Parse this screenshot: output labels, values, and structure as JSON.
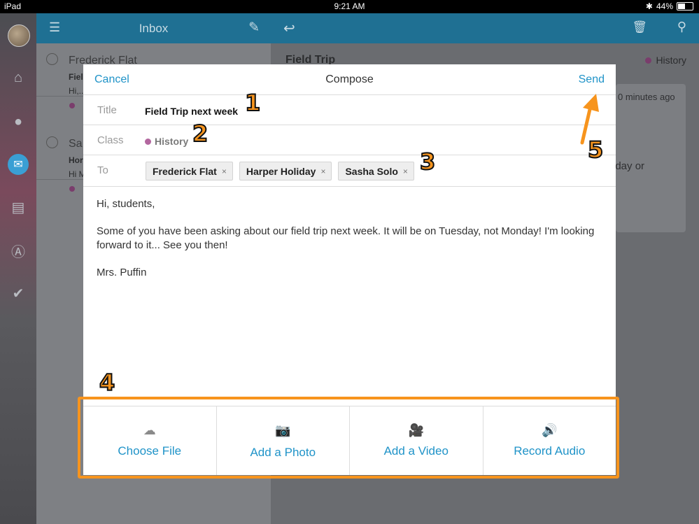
{
  "status_bar": {
    "device": "iPad",
    "time": "9:21 AM",
    "battery": "44%"
  },
  "inbox": {
    "title": "Inbox",
    "messages": [
      {
        "from": "Frederick Flat",
        "subject": "Fiel",
        "preview": "Hi,..."
      },
      {
        "from": "Sa",
        "subject": "Hor",
        "preview": "Hi M"
      }
    ]
  },
  "detail": {
    "subject": "Field Trip",
    "class": "History",
    "time": "0 minutes ago",
    "snippet": "nday or"
  },
  "compose": {
    "cancel": "Cancel",
    "title": "Compose",
    "send": "Send",
    "title_label": "Title",
    "title_value": "Field Trip next week",
    "class_label": "Class",
    "class_value": "History",
    "to_label": "To",
    "recipients": [
      "Frederick Flat",
      "Harper Holiday",
      "Sasha Solo"
    ],
    "body": [
      "Hi, students,",
      "Some of you have been asking about our field trip next week. It will be on Tuesday, not Monday! I'm looking forward to it... See you then!",
      "Mrs. Puffin"
    ],
    "remove_glyph": "×"
  },
  "attachments": [
    {
      "label": "Choose File",
      "icon": "cloud-upload-icon"
    },
    {
      "label": "Add a Photo",
      "icon": "camera-icon"
    },
    {
      "label": "Add a Video",
      "icon": "video-camera-icon"
    },
    {
      "label": "Record Audio",
      "icon": "speaker-icon"
    }
  ],
  "callouts": [
    "1",
    "2",
    "3",
    "4",
    "5"
  ],
  "colors": {
    "accent": "#1f93c8",
    "header": "#1f7093",
    "highlight": "#f7941d",
    "class_dot": "#b3679f"
  }
}
